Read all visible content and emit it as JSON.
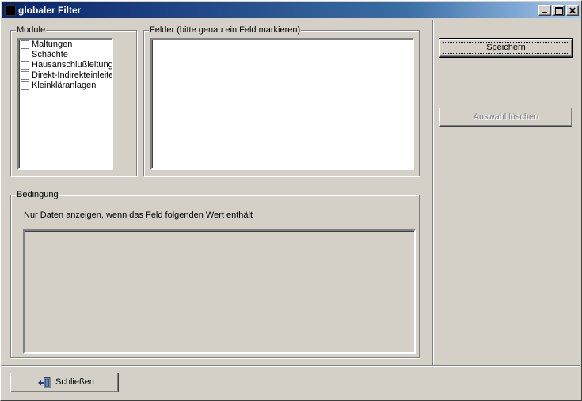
{
  "window": {
    "title": "globaler Filter"
  },
  "module_group": {
    "legend": "Module",
    "items": [
      {
        "label": "Maltungen",
        "checked": false
      },
      {
        "label": "Schächte",
        "checked": false
      },
      {
        "label": "Hausanschlußleitung",
        "checked": false
      },
      {
        "label": "Direkt-Indirekteinleite",
        "checked": false
      },
      {
        "label": "Kleinkläranlagen",
        "checked": false
      }
    ]
  },
  "felder_group": {
    "legend": "Felder (bitte genau ein Feld markieren)",
    "items": []
  },
  "bedingung_group": {
    "legend": "Bedingung",
    "hint": "Nur Daten anzeigen, wenn das Feld folgenden Wert enthält",
    "value": ""
  },
  "buttons": {
    "save_label": "Speichern",
    "clear_label": "Auswahl löschen",
    "close_label": "Schließen"
  },
  "icons": {
    "close_button_icon": "door-exit-icon"
  },
  "colors": {
    "titlebar_start": "#0a246a",
    "titlebar_end": "#a6caf0",
    "face": "#d4d0c8"
  }
}
